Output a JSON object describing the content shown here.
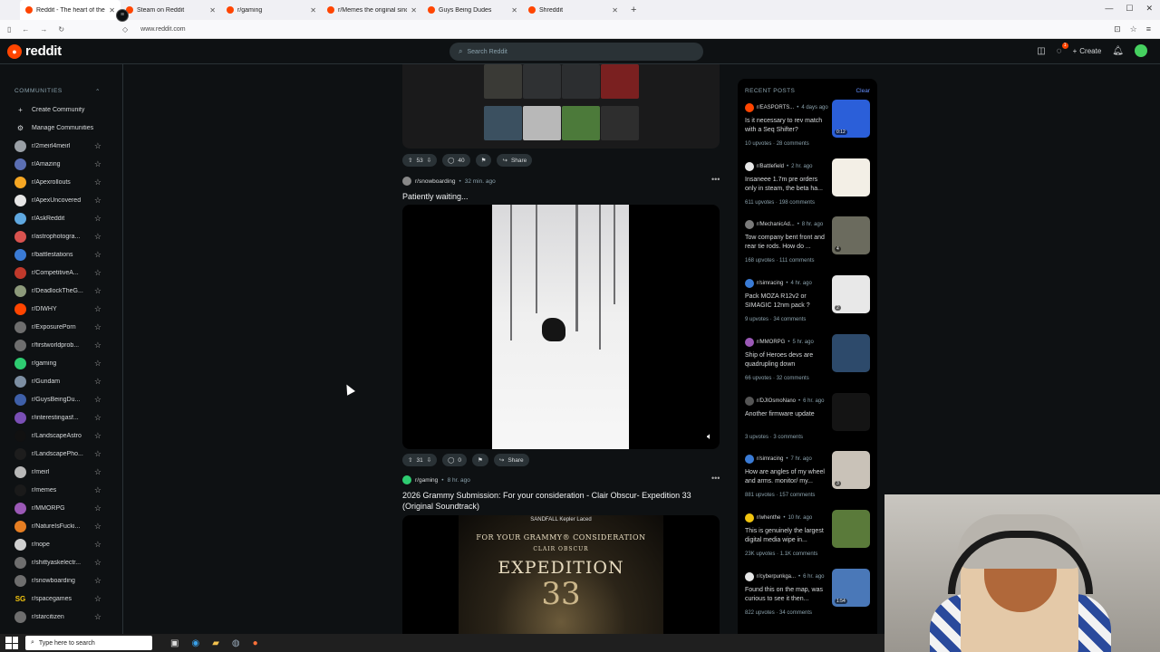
{
  "browser": {
    "tabs": [
      {
        "title": "Reddit - The heart of the internet",
        "active": true
      },
      {
        "title": "Steam on Reddit",
        "active": false
      },
      {
        "title": "r/gaming",
        "active": false
      },
      {
        "title": "r/Memes the original since 2008",
        "active": false
      },
      {
        "title": "Guys Being Dudes",
        "active": false
      },
      {
        "title": "Shreddit",
        "active": false
      }
    ],
    "url": "www.reddit.com"
  },
  "header": {
    "logo_text": "reddit",
    "search_placeholder": "Search Reddit",
    "create_label": "Create",
    "chat_badge": "1"
  },
  "sidebar": {
    "section_title": "COMMUNITIES",
    "actions": [
      {
        "label": "Create Community",
        "icon": "plus-icon"
      },
      {
        "label": "Manage Communities",
        "icon": "gear-icon"
      }
    ],
    "communities": [
      {
        "name": "r/2meirl4meirl",
        "color": "#9aa0a6"
      },
      {
        "name": "r/Amazing",
        "color": "#5b6fb3"
      },
      {
        "name": "r/Apexrollouts",
        "color": "#f5a623"
      },
      {
        "name": "r/ApexUncovered",
        "color": "#e6e6e6"
      },
      {
        "name": "r/AskReddit",
        "color": "#5fa8e0"
      },
      {
        "name": "r/astrophotogra...",
        "color": "#d9534f"
      },
      {
        "name": "r/battlestations",
        "color": "#3a7bd5"
      },
      {
        "name": "r/CompetitiveA...",
        "color": "#c0392b"
      },
      {
        "name": "r/DeadlockTheG...",
        "color": "#8d9a7b"
      },
      {
        "name": "r/DIWHY",
        "color": "#ff4500"
      },
      {
        "name": "r/ExposurePorn",
        "color": "#6e6e6e"
      },
      {
        "name": "r/firstworldprob...",
        "color": "#6e6e6e"
      },
      {
        "name": "r/gaming",
        "color": "#2ecc71"
      },
      {
        "name": "r/Gundam",
        "color": "#7d8fa3"
      },
      {
        "name": "r/GuysBeingDu...",
        "color": "#3e5fa8"
      },
      {
        "name": "r/interestingasf...",
        "color": "#7a4fb5"
      },
      {
        "name": "r/LandscapeAstro",
        "color": "#111111"
      },
      {
        "name": "r/LandscapePho...",
        "color": "#1d1d1d"
      },
      {
        "name": "r/meirl",
        "color": "#b8b8b8"
      },
      {
        "name": "r/memes",
        "color": "#1a1a1a"
      },
      {
        "name": "r/MMORPG",
        "color": "#9b59b6"
      },
      {
        "name": "r/NatureIsFucki...",
        "color": "#e67e22"
      },
      {
        "name": "r/nope",
        "color": "#d0d0d0"
      },
      {
        "name": "r/shittyaskelectr...",
        "color": "#6e6e6e"
      },
      {
        "name": "r/snowboarding",
        "color": "#6e6e6e"
      },
      {
        "name": "r/spacegames",
        "color": "#0e1113",
        "initials": "SG"
      },
      {
        "name": "r/starcitizen",
        "color": "#6e6e6e"
      }
    ]
  },
  "feed": {
    "post1_actions": {
      "upvotes": "53",
      "comments": "40",
      "share": "Share"
    },
    "post2": {
      "subreddit": "r/snowboarding",
      "time": "32 min. ago",
      "title": "Patiently waiting...",
      "upvotes": "31",
      "comments": "0",
      "share": "Share"
    },
    "post3": {
      "subreddit": "r/gaming",
      "time": "8 hr. ago",
      "title": "2026 Grammy Submission: For your consideration - Clair Obscur- Expedition 33 (Original Soundtrack)",
      "poster_top": "SANDFALL  Kepler  Laced",
      "poster_line1": "FOR YOUR GRAMMY® CONSIDERATION",
      "poster_line2": "CLAIR OBSCUR",
      "poster_line3": "EXPEDITION",
      "poster_line4": "33"
    }
  },
  "recent": {
    "title": "RECENT POSTS",
    "clear": "Clear",
    "posts": [
      {
        "sub": "r/EASPORTS...",
        "time": "4 days ago",
        "title": "Is it necessary to rev match with a Seq Shifter?",
        "upvotes": "10 upvotes",
        "comments": "28 comments",
        "icon_color": "#ff4500",
        "thumb": "#2b5fd9",
        "thumb_label": "0:12"
      },
      {
        "sub": "r/Battlefield",
        "time": "2 hr. ago",
        "title": "Insaneee 1.7m pre orders only in steam, the beta ha...",
        "upvotes": "611 upvotes",
        "comments": "198 comments",
        "icon_color": "#e6e6e6",
        "thumb": "#f3efe6",
        "thumb_label": ""
      },
      {
        "sub": "r/MechanicAd...",
        "time": "8 hr. ago",
        "title": "Tow company bent front and rear tie rods. How do ...",
        "upvotes": "168 upvotes",
        "comments": "111 comments",
        "icon_color": "#7a7a7a",
        "thumb": "#6b6b5e",
        "thumb_label": "4"
      },
      {
        "sub": "r/simracing",
        "time": "4 hr. ago",
        "title": "Pack MOZA R12v2 or SIMAGIC 12nm pack ?",
        "upvotes": "9 upvotes",
        "comments": "34 comments",
        "icon_color": "#3a7bd5",
        "thumb": "#e8e8e8",
        "thumb_label": "2"
      },
      {
        "sub": "r/MMORPG",
        "time": "5 hr. ago",
        "title": "Ship of Heroes devs are quadrupling down",
        "upvotes": "66 upvotes",
        "comments": "32 comments",
        "icon_color": "#9b59b6",
        "thumb": "#2d4a6b",
        "thumb_label": ""
      },
      {
        "sub": "r/DJIOsmoNano",
        "time": "6 hr. ago",
        "title": "Another firmware update",
        "upvotes": "3 upvotes",
        "comments": "3 comments",
        "icon_color": "#555555",
        "thumb": "#141414",
        "thumb_label": ""
      },
      {
        "sub": "r/simracing",
        "time": "7 hr. ago",
        "title": "How are angles of my wheel and arms. monitor/ my...",
        "upvotes": "881 upvotes",
        "comments": "157 comments",
        "icon_color": "#3a7bd5",
        "thumb": "#c9c2b8",
        "thumb_label": "3"
      },
      {
        "sub": "r/whenthe",
        "time": "10 hr. ago",
        "title": "This is genuinely the largest digital media wipe in...",
        "upvotes": "23K upvotes",
        "comments": "1.1K comments",
        "icon_color": "#f1c40f",
        "thumb": "#5a7a3a",
        "thumb_label": ""
      },
      {
        "sub": "r/cyberpunkga...",
        "time": "6 hr. ago",
        "title": "Found this on the map, was curious to see it then...",
        "upvotes": "822 upvotes",
        "comments": "34 comments",
        "icon_color": "#e6e6e6",
        "thumb": "#4a78b8",
        "thumb_label": "1:54"
      }
    ]
  },
  "taskbar": {
    "search_placeholder": "Type here to search"
  }
}
